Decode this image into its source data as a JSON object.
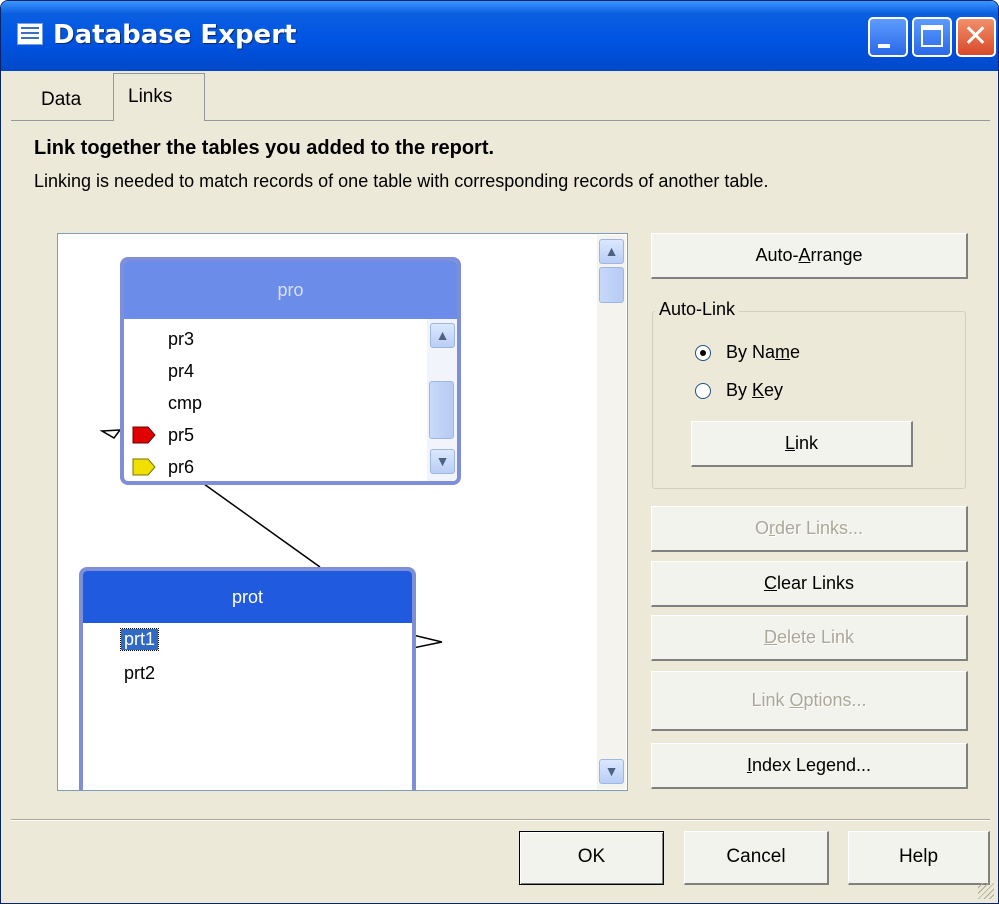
{
  "window": {
    "title": "Database Expert",
    "icon": "database-icon"
  },
  "title_buttons": {
    "minimize": "minimize-icon",
    "maximize": "maximize-icon",
    "close": "close-icon"
  },
  "tabs": [
    {
      "label": "Data",
      "active": false
    },
    {
      "label": "Links",
      "active": true
    }
  ],
  "instructions": {
    "heading": "Link together the tables you added to the report.",
    "description": "Linking is needed to match records of one table with corresponding records of another table."
  },
  "tables": [
    {
      "name": "pro",
      "fields": [
        {
          "name": "pr3"
        },
        {
          "name": "pr4"
        },
        {
          "name": "cmp"
        },
        {
          "name": "pr5",
          "index_color": "#e00000"
        },
        {
          "name": "pr6",
          "index_color": "#f0e000"
        }
      ]
    },
    {
      "name": "prot",
      "fields": [
        {
          "name": "prt1",
          "selected": true
        },
        {
          "name": "prt2"
        }
      ]
    }
  ],
  "buttons": {
    "auto_arrange": {
      "pre": "Auto-",
      "key": "A",
      "post": "rrange"
    },
    "link": {
      "pre": "",
      "key": "L",
      "post": "ink"
    },
    "order_links": {
      "pre": "O",
      "key": "r",
      "post": "der Links...",
      "enabled": false
    },
    "clear_links": {
      "pre": "",
      "key": "C",
      "post": "lear Links",
      "enabled": true
    },
    "delete_link": {
      "pre": "",
      "key": "D",
      "post": "elete Link",
      "enabled": false
    },
    "link_options": {
      "pre": "Link ",
      "key": "O",
      "post": "ptions...",
      "enabled": false
    },
    "index_legend": {
      "pre": "",
      "key": "I",
      "post": "ndex Legend...",
      "enabled": true
    },
    "ok": "OK",
    "cancel": "Cancel",
    "help": "Help"
  },
  "auto_link": {
    "label": "Auto-Link",
    "options": [
      {
        "pre": "By Na",
        "key": "m",
        "post": "e",
        "checked": true
      },
      {
        "pre": "By ",
        "key": "K",
        "post": "ey",
        "checked": false
      }
    ]
  },
  "colors": {
    "title_bar": "#0054e3",
    "table_header": "#1f5adf",
    "table_header_faded": "#6b8ce8",
    "selection": "#316ac5",
    "disabled_text": "#aca899"
  }
}
